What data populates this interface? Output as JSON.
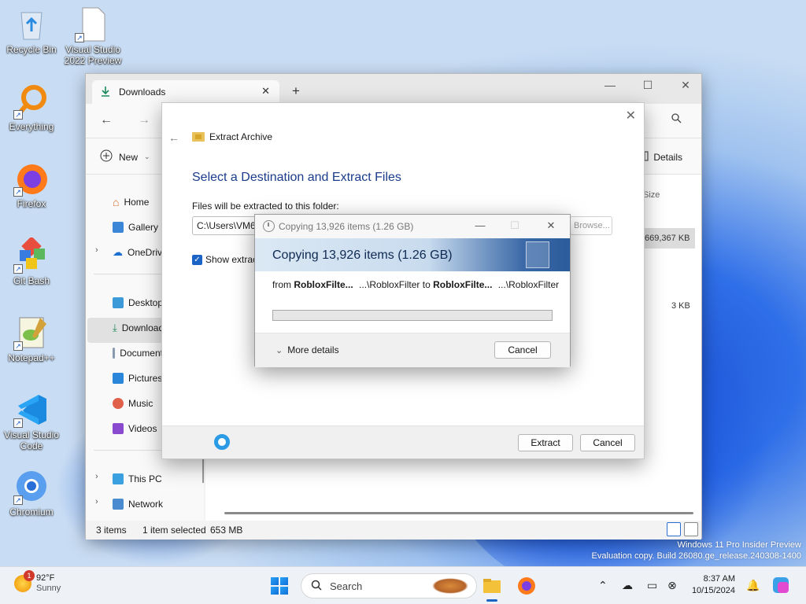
{
  "desktop": {
    "icons": [
      {
        "label": "Recycle Bin",
        "icon": "recycle-bin-icon"
      },
      {
        "label": "Visual Studio 2022 Preview",
        "icon": "file-icon"
      },
      {
        "label": "Everything",
        "icon": "magnifier-icon"
      },
      {
        "label": "Firefox",
        "icon": "firefox-icon"
      },
      {
        "label": "Git Bash",
        "icon": "git-icon"
      },
      {
        "label": "Notepad++",
        "icon": "notepadpp-icon"
      },
      {
        "label": "Visual Studio Code",
        "icon": "vscode-icon"
      },
      {
        "label": "Chromium",
        "icon": "chromium-icon"
      }
    ]
  },
  "explorer": {
    "tab_label": "Downloads",
    "toolbar": {
      "new_label": "New",
      "details_label": "Details"
    },
    "sidebar": [
      {
        "label": "Home"
      },
      {
        "label": "Gallery"
      },
      {
        "label": "OneDrive"
      },
      {
        "label": "Desktop"
      },
      {
        "label": "Downloads"
      },
      {
        "label": "Documents"
      },
      {
        "label": "Pictures"
      },
      {
        "label": "Music"
      },
      {
        "label": "Videos"
      },
      {
        "label": "This PC"
      },
      {
        "label": "Network"
      }
    ],
    "column_size_header": "Size",
    "sizes": [
      "669,367 KB",
      "3 KB"
    ],
    "status": {
      "items": "3 items",
      "selected": "1 item selected",
      "size": "653 MB"
    }
  },
  "extract": {
    "title": "Extract Archive",
    "heading": "Select a Destination and Extract Files",
    "folder_label": "Files will be extracted to this folder:",
    "path_value": "C:\\Users\\VM6",
    "browse_label": "Browse...",
    "show_files_label": "Show extracted files when complete",
    "extract_button": "Extract",
    "cancel_button": "Cancel"
  },
  "copy": {
    "title": "Copying 13,926 items (1.26 GB)",
    "banner": "Copying 13,926 items (1.26 GB)",
    "from_prefix": "from",
    "from_name": "RobloxFilte...",
    "from_path": "...\\RobloxFilter",
    "to_word": "to",
    "to_name": "RobloxFilte...",
    "to_path": "...\\RobloxFilter",
    "progress_fraction": 0,
    "more_details": "More details",
    "cancel_button": "Cancel"
  },
  "watermark": {
    "line1": "Windows 11 Pro Insider Preview",
    "line2": "Evaluation copy. Build 26080.ge_release.240308-1400"
  },
  "taskbar": {
    "weather_temp": "92°F",
    "weather_cond": "Sunny",
    "weather_badge": "1",
    "search_placeholder": "Search",
    "time": "8:37 AM",
    "date": "10/15/2024"
  },
  "colors": {
    "accent": "#1b63c4",
    "spinner": "#2a9be4",
    "heading": "#1a3c8b"
  }
}
